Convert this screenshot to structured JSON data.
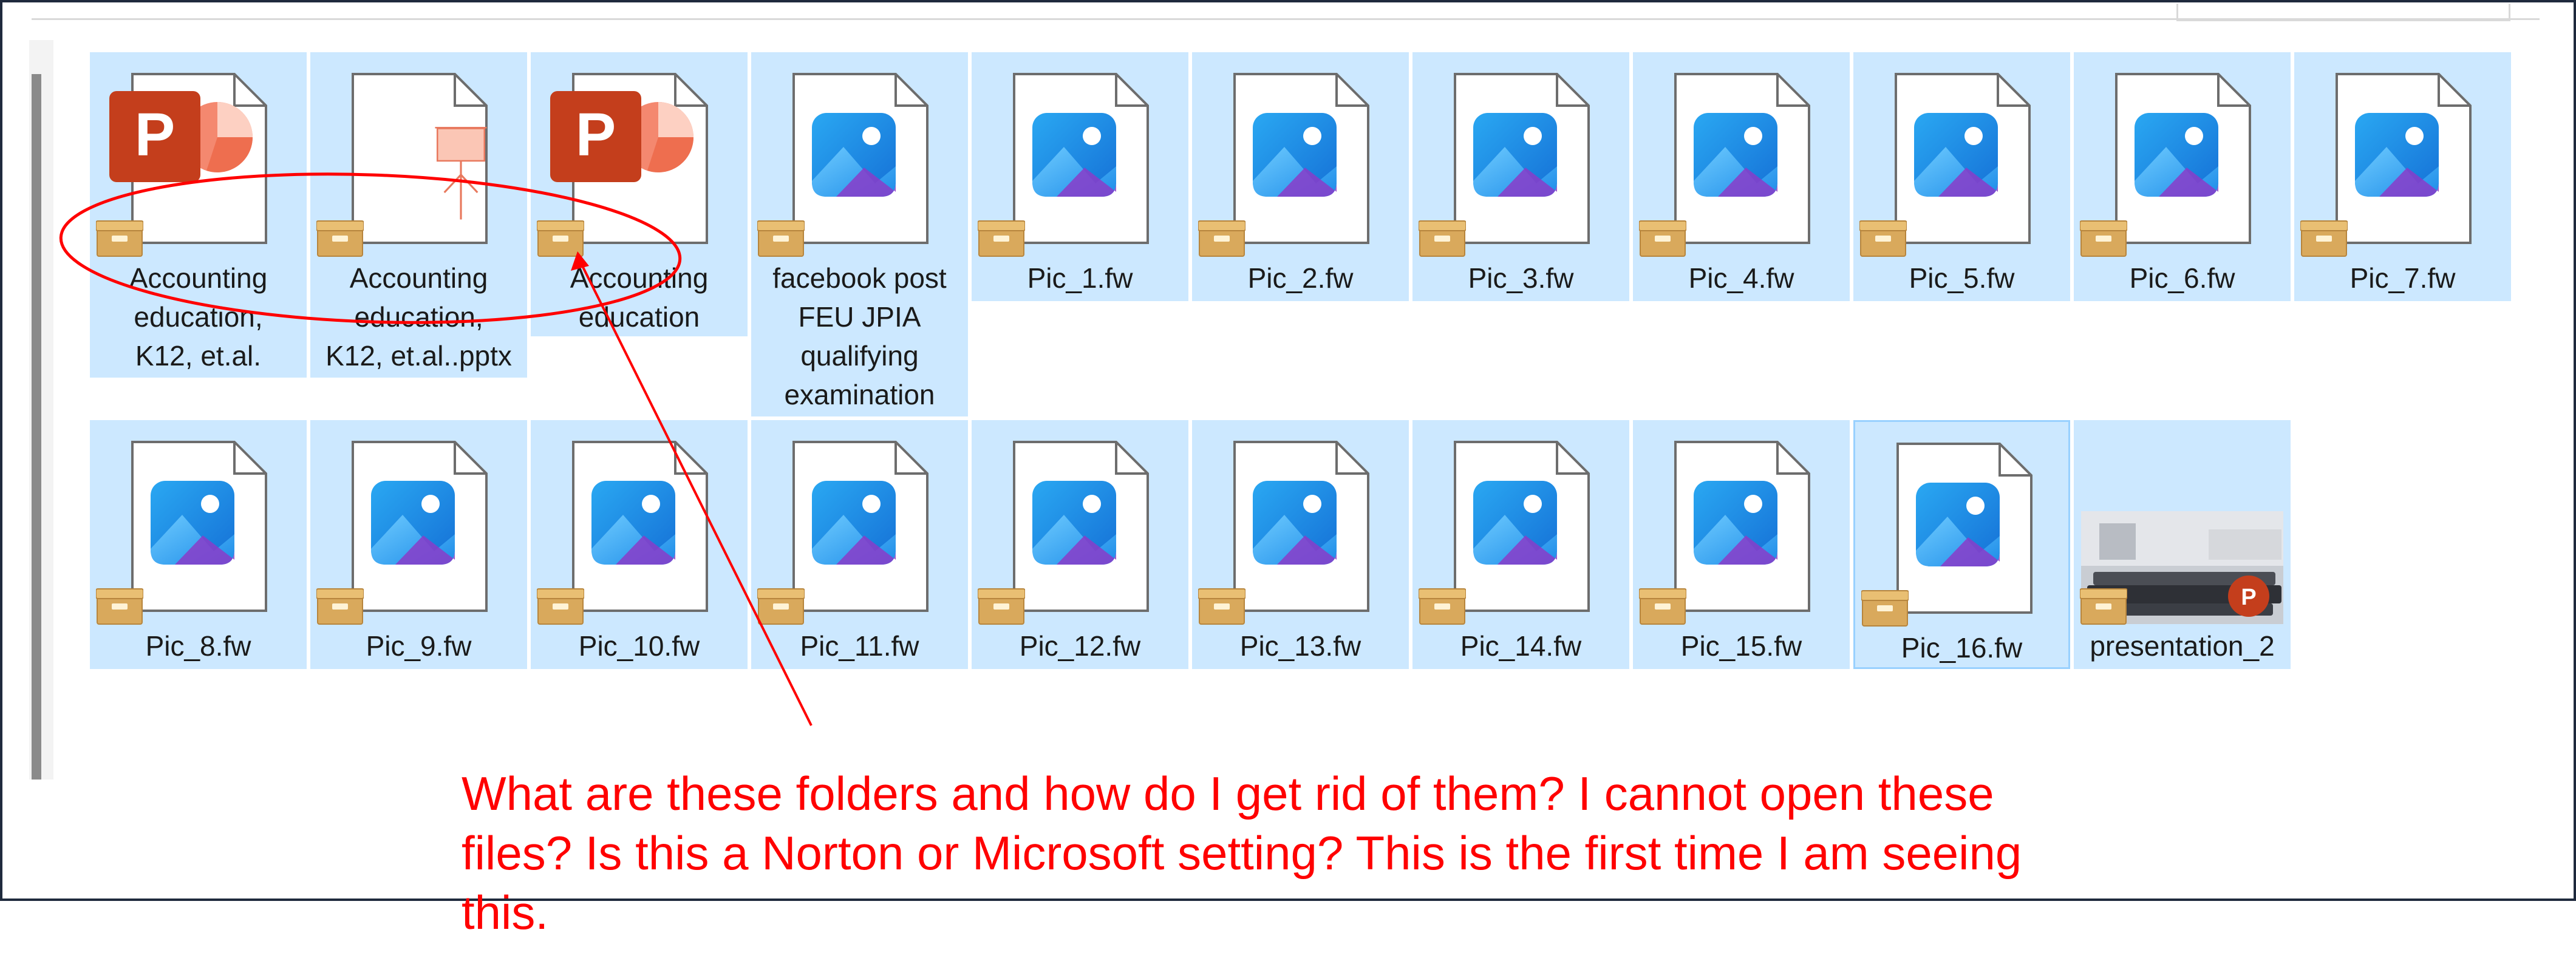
{
  "explorer": {
    "files": [
      {
        "name": "Accounting education, K12, et.al.",
        "label_lines": [
          "Accounting",
          "education,",
          "K12, et.al."
        ],
        "icon": "powerpoint-icon",
        "badge": "archive-box-icon"
      },
      {
        "name": "Accounting education, K12, et.al..pptx",
        "label_lines": [
          "Accounting",
          "education,",
          "K12, et.al..pptx"
        ],
        "icon": "presentation-easel-icon",
        "badge": "archive-box-icon"
      },
      {
        "name": "Accounting education",
        "label_lines": [
          "Accounting",
          "education"
        ],
        "icon": "powerpoint-icon",
        "badge": "archive-box-icon"
      },
      {
        "name": "facebook post FEU JPIA qualifying examination",
        "label_lines": [
          "facebook post",
          "FEU JPIA",
          "qualifying",
          "examination"
        ],
        "icon": "photos-icon",
        "badge": "archive-box-icon"
      },
      {
        "name": "Pic_1.fw",
        "label_lines": [
          "Pic_1.fw"
        ],
        "icon": "photos-icon",
        "badge": "archive-box-icon"
      },
      {
        "name": "Pic_2.fw",
        "label_lines": [
          "Pic_2.fw"
        ],
        "icon": "photos-icon",
        "badge": "archive-box-icon"
      },
      {
        "name": "Pic_3.fw",
        "label_lines": [
          "Pic_3.fw"
        ],
        "icon": "photos-icon",
        "badge": "archive-box-icon"
      },
      {
        "name": "Pic_4.fw",
        "label_lines": [
          "Pic_4.fw"
        ],
        "icon": "photos-icon",
        "badge": "archive-box-icon"
      },
      {
        "name": "Pic_5.fw",
        "label_lines": [
          "Pic_5.fw"
        ],
        "icon": "photos-icon",
        "badge": "archive-box-icon"
      },
      {
        "name": "Pic_6.fw",
        "label_lines": [
          "Pic_6.fw"
        ],
        "icon": "photos-icon",
        "badge": "archive-box-icon"
      },
      {
        "name": "Pic_7.fw",
        "label_lines": [
          "Pic_7.fw"
        ],
        "icon": "photos-icon",
        "badge": "archive-box-icon"
      },
      {
        "name": "Pic_8.fw",
        "label_lines": [
          "Pic_8.fw"
        ],
        "icon": "photos-icon",
        "badge": "archive-box-icon"
      },
      {
        "name": "Pic_9.fw",
        "label_lines": [
          "Pic_9.fw"
        ],
        "icon": "photos-icon",
        "badge": "archive-box-icon"
      },
      {
        "name": "Pic_10.fw",
        "label_lines": [
          "Pic_10.fw"
        ],
        "icon": "photos-icon",
        "badge": "archive-box-icon"
      },
      {
        "name": "Pic_11.fw",
        "label_lines": [
          "Pic_11.fw"
        ],
        "icon": "photos-icon",
        "badge": "archive-box-icon"
      },
      {
        "name": "Pic_12.fw",
        "label_lines": [
          "Pic_12.fw"
        ],
        "icon": "photos-icon",
        "badge": "archive-box-icon"
      },
      {
        "name": "Pic_13.fw",
        "label_lines": [
          "Pic_13.fw"
        ],
        "icon": "photos-icon",
        "badge": "archive-box-icon"
      },
      {
        "name": "Pic_14.fw",
        "label_lines": [
          "Pic_14.fw"
        ],
        "icon": "photos-icon",
        "badge": "archive-box-icon"
      },
      {
        "name": "Pic_15.fw",
        "label_lines": [
          "Pic_15.fw"
        ],
        "icon": "photos-icon",
        "badge": "archive-box-icon"
      },
      {
        "name": "Pic_16.fw",
        "label_lines": [
          "Pic_16.fw"
        ],
        "icon": "photos-icon",
        "badge": "archive-box-icon"
      },
      {
        "name": "presentation_2",
        "label_lines": [
          "presentation_2"
        ],
        "icon": "laptop-thumbnail-with-powerpoint-icon",
        "badge": "archive-box-icon"
      }
    ]
  },
  "annotation": {
    "lines": [
      "What are these folders and how do I get rid of them? I cannot open these",
      "files? Is this a Norton or Microsoft setting? This is the first time I am seeing",
      "this."
    ],
    "color": "#ff0000"
  },
  "colors": {
    "selection": "#cce8ff",
    "focus_border": "#99d1ff",
    "annotation": "#ff0000",
    "powerpoint": "#c43e1c",
    "archive_badge": "#d9a95c"
  }
}
